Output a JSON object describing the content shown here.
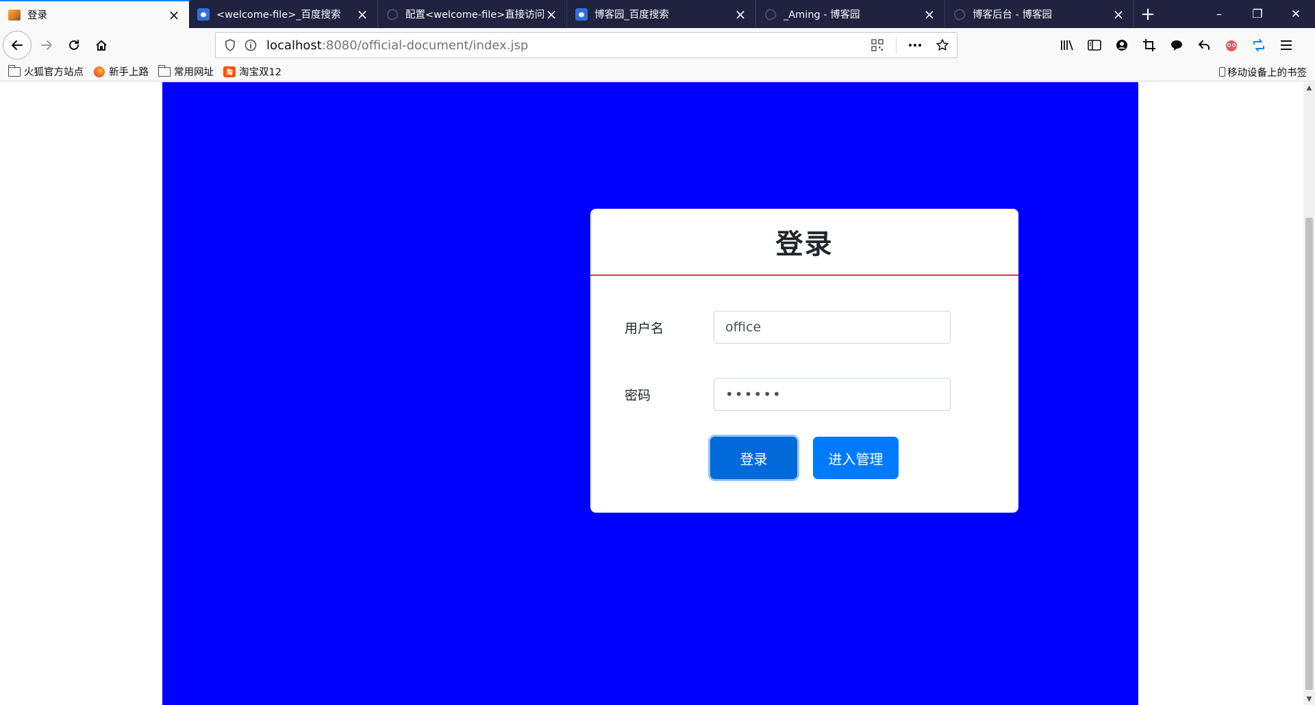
{
  "tabs": [
    {
      "title": "登录",
      "icon": "login-page-icon",
      "active": true
    },
    {
      "title": "<welcome-file>_百度搜索",
      "icon": "baidu-paw-icon"
    },
    {
      "title": "配置<welcome-file>直接访问",
      "icon": "cnblogs-icon"
    },
    {
      "title": "博客园_百度搜索",
      "icon": "baidu-paw-icon"
    },
    {
      "title": "_Aming - 博客园",
      "icon": "cnblogs-icon"
    },
    {
      "title": "博客后台 - 博客园",
      "icon": "cnblogs-icon"
    }
  ],
  "window_controls": {
    "minimize": "–",
    "restore": "❐",
    "close": "✕"
  },
  "nav": {
    "url_host": "localhost",
    "url_rest": ":8080/official-document/index.jsp"
  },
  "bookmarks": [
    {
      "label": "火狐官方站点",
      "icon": "folder-icon"
    },
    {
      "label": "新手上路",
      "icon": "firefox-icon"
    },
    {
      "label": "常用网址",
      "icon": "folder-icon"
    },
    {
      "label": "淘宝双12",
      "icon": "taobao-icon"
    }
  ],
  "mobile_bookmarks": "移动设备上的书签",
  "login": {
    "title": "登录",
    "username_label": "用户名",
    "username_value": "office",
    "password_label": "密码",
    "password_value": "••••••",
    "login_button": "登录",
    "admin_button": "进入管理"
  },
  "colors": {
    "page_panel": "#0000ff",
    "header_divider": "#dc3545",
    "primary_button": "#007bff",
    "tab_strip": "#202340"
  }
}
